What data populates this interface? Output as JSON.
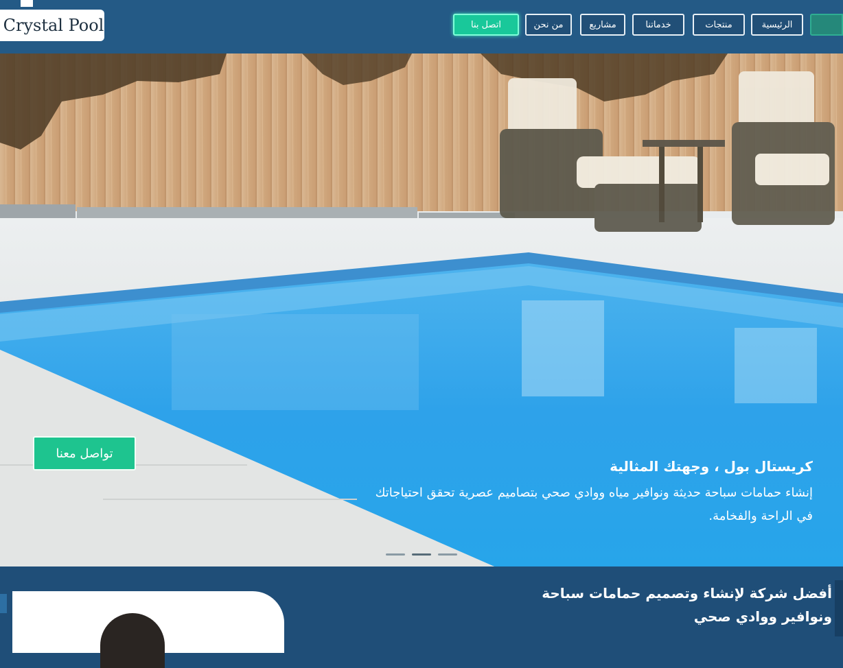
{
  "header": {
    "logo_text": "Crystal Pool",
    "nav": [
      {
        "label": "اتصل بنا"
      },
      {
        "label": "من نحن"
      },
      {
        "label": "مشاريع"
      },
      {
        "label": "خدماتنا"
      },
      {
        "label": "منتجات"
      },
      {
        "label": "الرئيسية"
      }
    ]
  },
  "hero": {
    "title": "كريستال بول ، وجهتك المثالية",
    "subtitle": "إنشاء حمامات سباحة حديثة ونوافير مياه ووادي صحي بتصاميم عصرية تحقق احتياجاتك في الراحة والفخامة.",
    "cta_label": "تواصل معنا"
  },
  "intro": {
    "line1": "أفضل شركة لإنشاء وتصميم حمامات سباحة",
    "line2": "ونوافير ووادي صحي"
  },
  "colors": {
    "header_bg": "#245a86",
    "accent": "#19c89a",
    "section_bg": "#1f4e78"
  }
}
